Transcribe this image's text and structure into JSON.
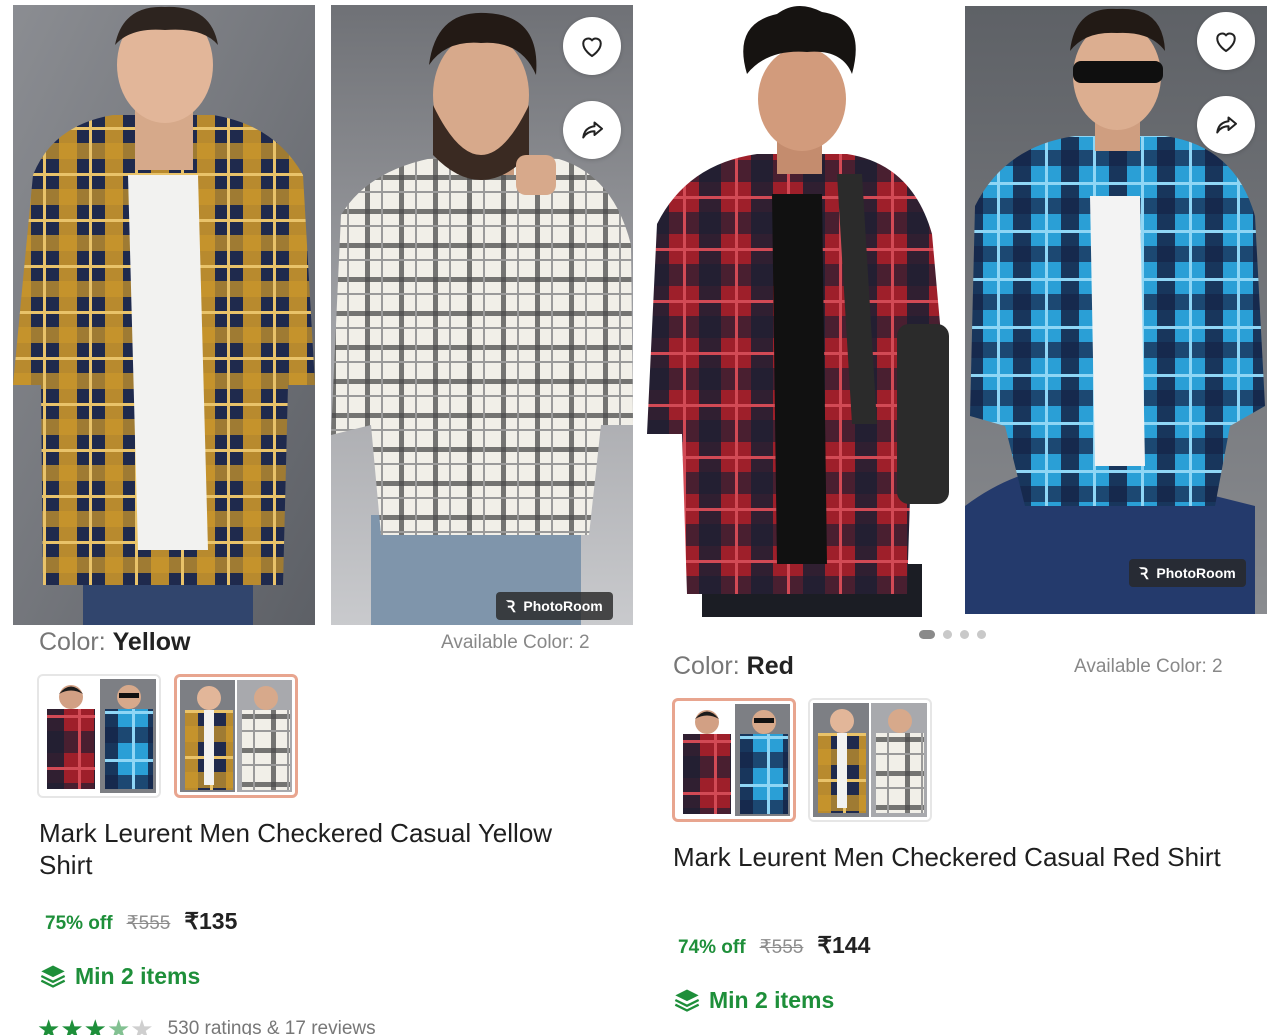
{
  "products": [
    {
      "color_label": "Color:",
      "color_value": "Yellow",
      "available_colors": "Available Color: 2",
      "title": "Mark Leurent Men Checkered Casual Yellow Shirt",
      "discount": "75% off",
      "mrp": "₹555",
      "price": "₹135",
      "min_items": "Min 2 items",
      "ratings_text": "530 ratings  & 17 reviews",
      "rating_stars": 3.5,
      "watermark": "PhotoRoom",
      "swatches": [
        {
          "name": "red-blue-variant",
          "selected": false
        },
        {
          "name": "yellow-white-variant",
          "selected": true
        }
      ]
    },
    {
      "color_label": "Color:",
      "color_value": "Red",
      "available_colors": "Available Color: 2",
      "title": "Mark Leurent Men Checkered Casual Red Shirt",
      "discount": "74% off",
      "mrp": "₹555",
      "price": "₹144",
      "min_items": "Min 2 items",
      "watermark": "PhotoRoom",
      "carousel_pages": 4,
      "carousel_active": 1,
      "swatches": [
        {
          "name": "red-blue-variant",
          "selected": true
        },
        {
          "name": "yellow-white-variant",
          "selected": false
        }
      ]
    }
  ],
  "icons": {
    "wishlist": "heart-icon",
    "share": "share-icon",
    "min_items": "layers-icon"
  },
  "colors": {
    "discount_green": "#1e8f3a",
    "selected_border": "#e8a58f",
    "yellow_check": "#c9952a",
    "navy_check": "#1f2a4d",
    "red_check": "#9e1f2a",
    "blue_check": "#2a9fd6",
    "white_check": "#f1efe8"
  }
}
